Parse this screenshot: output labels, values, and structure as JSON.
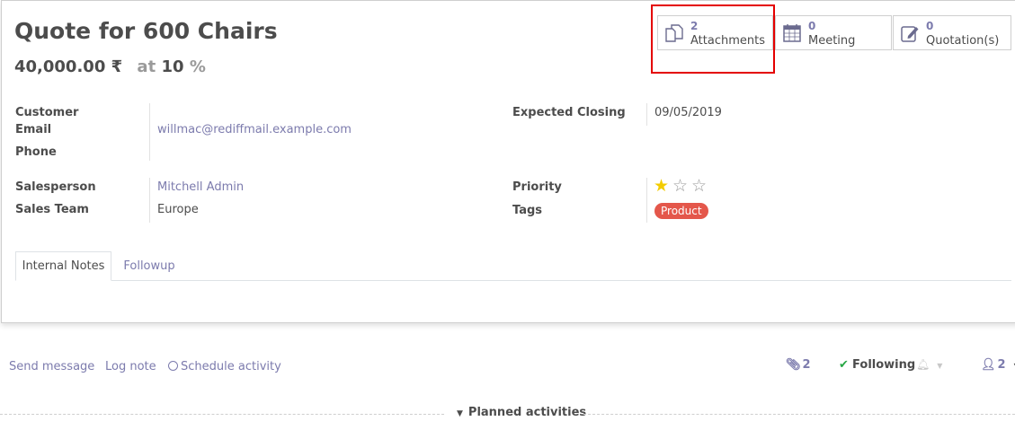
{
  "record": {
    "title": "Quote for 600 Chairs",
    "expected_revenue": "40,000.00 ₹",
    "at_label": "at",
    "probability": "10",
    "percent_sign": "%"
  },
  "smart_buttons": {
    "attachments": {
      "count": "2",
      "label": "Attachments"
    },
    "meeting": {
      "count": "0",
      "label": "Meeting"
    },
    "quotations": {
      "count": "0",
      "label": "Quotation(s)"
    }
  },
  "fields": {
    "customer_label": "Customer",
    "email_label": "Email",
    "email_value": "willmac@rediffmail.example.com",
    "phone_label": "Phone",
    "expected_closing_label": "Expected Closing",
    "expected_closing_value": "09/05/2019",
    "salesperson_label": "Salesperson",
    "salesperson_value": "Mitchell Admin",
    "sales_team_label": "Sales Team",
    "sales_team_value": "Europe",
    "priority_label": "Priority",
    "priority_value": 1,
    "priority_max": 3,
    "tags_label": "Tags",
    "tags": [
      "Product"
    ]
  },
  "tabs": [
    {
      "label": "Internal Notes",
      "active": true
    },
    {
      "label": "Followup",
      "active": false
    }
  ],
  "chatter": {
    "send_message": "Send message",
    "log_note": "Log note",
    "schedule_activity": "Schedule activity",
    "attachment_count": "2",
    "following": "Following",
    "follower_count": "2",
    "planned_activities": "Planned activities"
  },
  "colors": {
    "accent": "#7c7bad",
    "tag": "#e4574b",
    "star_filled": "#f3cc00",
    "following_check": "#28a745",
    "highlight_box": "#e40000"
  }
}
